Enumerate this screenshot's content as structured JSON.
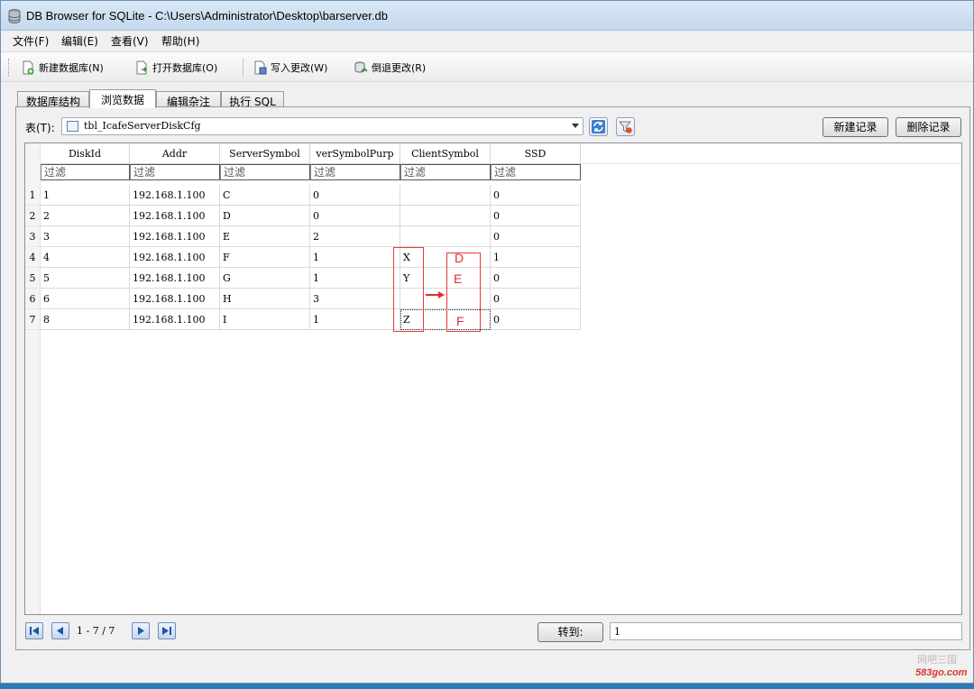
{
  "window": {
    "title": "DB Browser for SQLite - C:\\Users\\Administrator\\Desktop\\barserver.db"
  },
  "menu": [
    "文件(F)",
    "编辑(E)",
    "查看(V)",
    "帮助(H)"
  ],
  "toolbar": {
    "new_db": "新建数据库(N)",
    "open_db": "打开数据库(O)",
    "write_changes": "写入更改(W)",
    "revert_changes": "倒退更改(R)"
  },
  "tabs": [
    "数据库结构",
    "浏览数据",
    "编辑杂注",
    "执行 SQL"
  ],
  "active_tab": "浏览数据",
  "browse": {
    "table_label": "表(T):",
    "selected_table": "tbl_IcafeServerDiskCfg",
    "new_record": "新建记录",
    "delete_record": "删除记录",
    "filter_placeholder": "过滤",
    "columns": [
      "DiskId",
      "Addr",
      "ServerSymbol",
      "verSymbolPurp",
      "ClientSymbol",
      "SSD"
    ],
    "rows": [
      {
        "num": "1",
        "cells": [
          "1",
          "192.168.1.100",
          "C",
          "0",
          "",
          "0"
        ]
      },
      {
        "num": "2",
        "cells": [
          "2",
          "192.168.1.100",
          "D",
          "0",
          "",
          "0"
        ]
      },
      {
        "num": "3",
        "cells": [
          "3",
          "192.168.1.100",
          "E",
          "2",
          "",
          "0"
        ]
      },
      {
        "num": "4",
        "cells": [
          "4",
          "192.168.1.100",
          "F",
          "1",
          "X",
          "1"
        ]
      },
      {
        "num": "5",
        "cells": [
          "5",
          "192.168.1.100",
          "G",
          "1",
          "Y",
          "0"
        ]
      },
      {
        "num": "6",
        "cells": [
          "6",
          "192.168.1.100",
          "H",
          "3",
          "",
          "0"
        ]
      },
      {
        "num": "7",
        "cells": [
          "8",
          "192.168.1.100",
          "I",
          "1",
          "Z",
          "0"
        ]
      }
    ],
    "annotation_letters": [
      "D",
      "E",
      "F"
    ],
    "pager_text": "1 - 7 / 7",
    "goto_label": "转到:",
    "goto_value": "1"
  },
  "watermark": {
    "site": "583go.com",
    "cn": "网吧三国"
  },
  "colors": {
    "annotation": "#e42d2d",
    "titlebar": "#c6d8ed"
  }
}
